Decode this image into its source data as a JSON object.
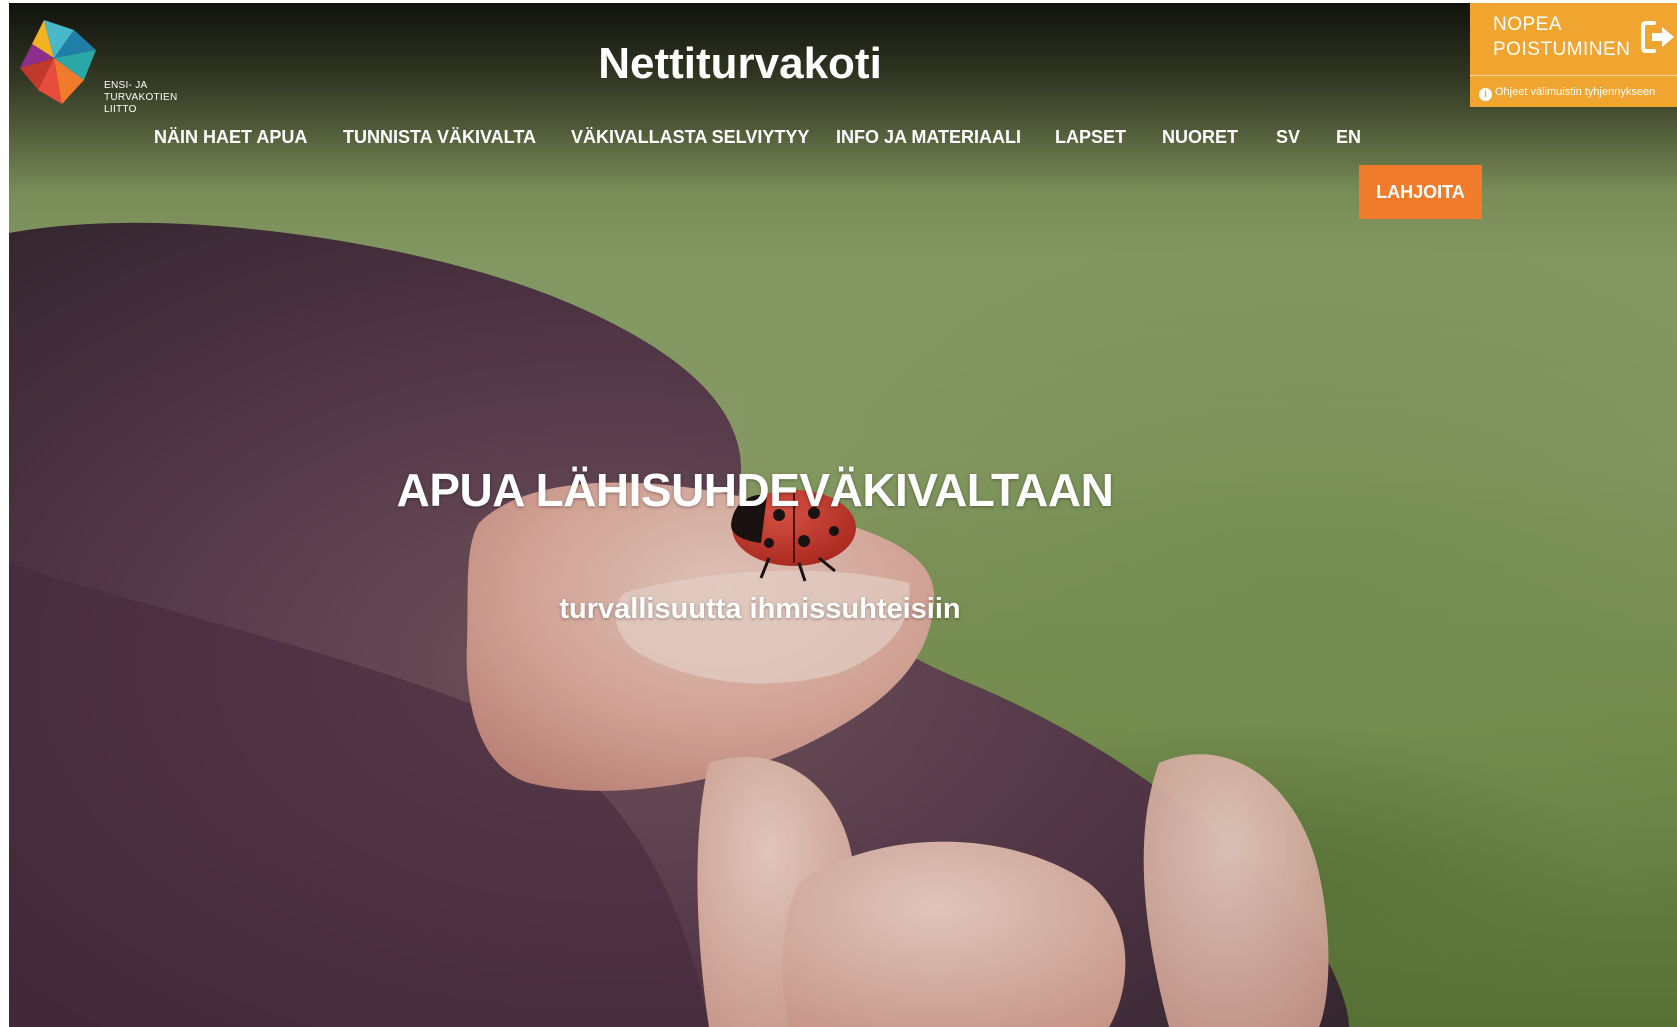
{
  "site": {
    "title": "Nettiturvakoti",
    "logo_text": "ENSI- JA\nTURVAKOTIEN\nLIITTO",
    "colors": {
      "accent_orange": "#f07b2a",
      "exit_panel": "#f1a531",
      "text": "#ffffff"
    }
  },
  "nav": {
    "items": [
      {
        "label": "NÄIN HAET APUA"
      },
      {
        "label": "TUNNISTA VÄKIVALTA"
      },
      {
        "label": "VÄKIVALLASTA SELVIYTYY"
      },
      {
        "label": "INFO JA MATERIAALI"
      },
      {
        "label": "LAPSET"
      },
      {
        "label": "NUORET"
      },
      {
        "label": "SV"
      },
      {
        "label": "EN"
      }
    ],
    "donate_label": "LAHJOITA"
  },
  "quick_exit": {
    "label": "NOPEA\nPOISTUMINEN",
    "icon": "exit-icon",
    "help_icon": "info-icon",
    "help_text": "Ohjeet välimuistin tyhjennykseen"
  },
  "hero": {
    "heading": "APUA LÄHISUHDEVÄKIVALTAAN",
    "subheading": "turvallisuutta ihmissuhteisiin"
  }
}
